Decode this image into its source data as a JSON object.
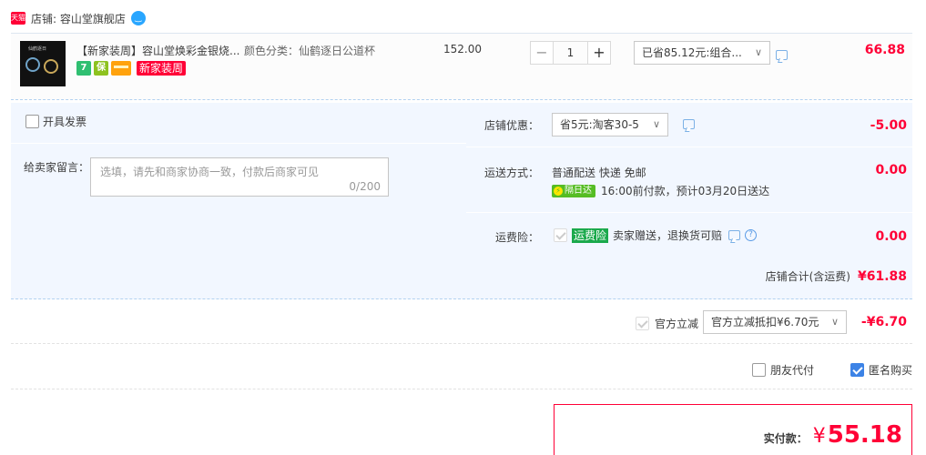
{
  "store": {
    "badge": "天猫",
    "label": "店铺: 容山堂旗舰店"
  },
  "item": {
    "thumb_caption": "仙鹤逐日",
    "title": "【新家装周】容山堂焕彩金银烧...",
    "sku": "颜色分类：仙鹤逐日公道杯",
    "tags": [
      "7",
      "保"
    ],
    "promo_tag": "新家装周",
    "unit_price": "152.00",
    "quantity": "1",
    "minus_label": "−",
    "plus_label": "+",
    "saved_label": "已省85.12元:组合...",
    "subtotal": "66.88"
  },
  "invoice": {
    "label": "开具发票"
  },
  "memo": {
    "label": "给卖家留言：",
    "placeholder": "选填，请先和商家协商一致，付款后商家可见",
    "counter": "0/200"
  },
  "store_coupon": {
    "label": "店铺优惠：",
    "selected": "省5元:淘客30-5",
    "amount": "-5.00"
  },
  "shipping": {
    "label": "运送方式：",
    "method": "普通配送 快递 免邮",
    "badge": "隔日达",
    "eta": "16:00前付款，预计03月20日送达",
    "amount": "0.00"
  },
  "freight_insurance": {
    "label": "运费险：",
    "badge": "运费险",
    "text": "卖家赠送，退换货可赔",
    "amount": "0.00"
  },
  "store_total": {
    "label": "店铺合计(含运费)",
    "amount": "¥61.88"
  },
  "official_discount": {
    "label": "官方立减",
    "selected": "官方立减抵扣¥6.70元",
    "amount": "-¥6.70"
  },
  "friend_pay": {
    "label": "朋友代付",
    "checked": false
  },
  "anonymous": {
    "label": "匿名购买",
    "checked": true
  },
  "payment": {
    "label": "实付款：",
    "currency": "¥",
    "amount": "55.18"
  },
  "colors": {
    "accent_red": "#ff0036",
    "panel_blue": "#f2f7ff",
    "check_blue": "#3c83e6"
  }
}
